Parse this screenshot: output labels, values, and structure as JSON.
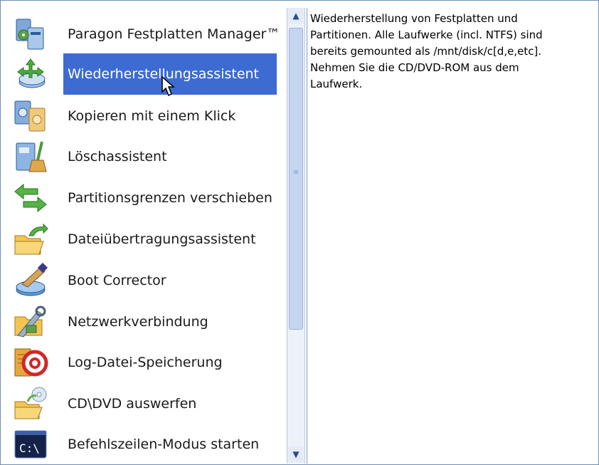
{
  "menu": {
    "items": [
      {
        "label": "Paragon Festplatten Manager™",
        "icon": "disk-manager-icon"
      },
      {
        "label": "Wiederherstellungsassistent",
        "icon": "recovery-wizard-icon"
      },
      {
        "label": "Kopieren mit einem Klick",
        "icon": "copy-disk-icon"
      },
      {
        "label": "Löschassistent",
        "icon": "wipe-broom-icon"
      },
      {
        "label": "Partitionsgrenzen verschieben",
        "icon": "move-arrows-icon"
      },
      {
        "label": "Dateiübertragungsassistent",
        "icon": "file-transfer-folder-icon"
      },
      {
        "label": "Boot Corrector",
        "icon": "boot-corrector-icon"
      },
      {
        "label": "Netzwerkverbindung",
        "icon": "network-tools-icon"
      },
      {
        "label": "Log-Datei-Speicherung",
        "icon": "log-at-icon"
      },
      {
        "label": "CD\\DVD auswerfen",
        "icon": "eject-cd-folder-icon"
      },
      {
        "label": "Befehlszeilen-Modus starten",
        "icon": "command-prompt-icon"
      }
    ],
    "selected_index": 1
  },
  "description": {
    "text": "Wiederherstellung von Festplatten und\nPartitionen. Alle Laufwerke (incl. NTFS) sind\nbereits gemounted als /mnt/disk/c[d,e,etc].\nNehmen Sie die CD/DVD-ROM aus dem\nLaufwerk."
  },
  "colors": {
    "selection": "#3d6bd1",
    "border": "#6f8fb8"
  }
}
